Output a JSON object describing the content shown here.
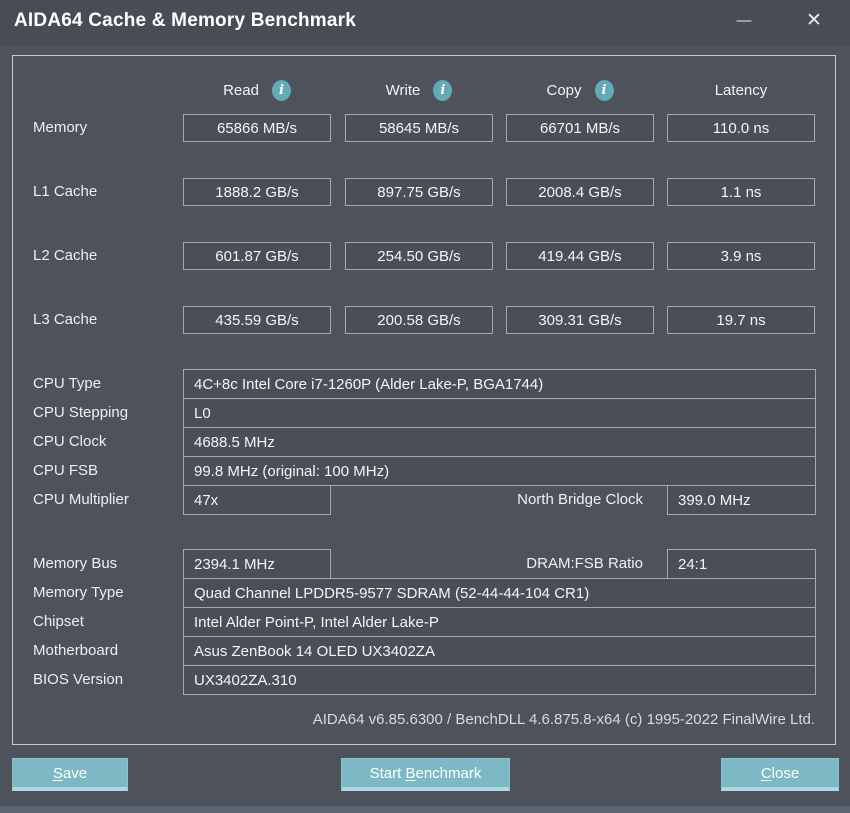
{
  "window": {
    "title": "AIDA64 Cache & Memory Benchmark",
    "minimize_icon": "—",
    "close_icon": "✕"
  },
  "colors": {
    "window_bg": "#4d525b",
    "titlebar_bg": "#484c55",
    "panel_border": "#c7c9cc",
    "box_bg": "#494e57",
    "box_border": "#a4a9b0",
    "info_icon_teal": "#64a9b7",
    "button_teal": "#7db8c5",
    "button_highlight": "#abdae2",
    "text": "#f4f5f7"
  },
  "info_icon_glyph": "i",
  "benchmark": {
    "columns": [
      {
        "label": "Read"
      },
      {
        "label": "Write"
      },
      {
        "label": "Copy"
      },
      {
        "label": "Latency"
      }
    ],
    "rows": [
      {
        "label": "Memory",
        "read": "65866 MB/s",
        "write": "58645 MB/s",
        "copy": "66701 MB/s",
        "latency": "110.0 ns"
      },
      {
        "label": "L1 Cache",
        "read": "1888.2 GB/s",
        "write": "897.75 GB/s",
        "copy": "2008.4 GB/s",
        "latency": "1.1 ns"
      },
      {
        "label": "L2 Cache",
        "read": "601.87 GB/s",
        "write": "254.50 GB/s",
        "copy": "419.44 GB/s",
        "latency": "3.9 ns"
      },
      {
        "label": "L3 Cache",
        "read": "435.59 GB/s",
        "write": "200.58 GB/s",
        "copy": "309.31 GB/s",
        "latency": "19.7 ns"
      }
    ]
  },
  "cpu_info": {
    "rows": [
      {
        "label": "CPU Type",
        "value": "4C+8c Intel Core i7-1260P  (Alder Lake-P, BGA1744)"
      },
      {
        "label": "CPU Stepping",
        "value": "L0"
      },
      {
        "label": "CPU Clock",
        "value": "4688.5 MHz"
      },
      {
        "label": "CPU FSB",
        "value": "99.8 MHz  (original: 100 MHz)"
      },
      {
        "label": "CPU Multiplier",
        "value": "47x",
        "right_label": "North Bridge Clock",
        "right_value": "399.0 MHz"
      }
    ]
  },
  "memory_info": {
    "rows": [
      {
        "label": "Memory Bus",
        "value": "2394.1 MHz",
        "right_label": "DRAM:FSB Ratio",
        "right_value": "24:1"
      },
      {
        "label": "Memory Type",
        "value": "Quad Channel LPDDR5-9577 SDRAM  (52-44-44-104 CR1)"
      },
      {
        "label": "Chipset",
        "value": "Intel Alder Point-P, Intel Alder Lake-P"
      },
      {
        "label": "Motherboard",
        "value": "Asus ZenBook 14 OLED UX3402ZA"
      },
      {
        "label": "BIOS Version",
        "value": "UX3402ZA.310"
      }
    ]
  },
  "footer": {
    "version_text": "AIDA64 v6.85.6300 / BenchDLL 4.6.875.8-x64  (c) 1995-2022 FinalWire Ltd."
  },
  "buttons": {
    "save": {
      "pre": "",
      "mnemonic": "S",
      "rest": "ave"
    },
    "start": {
      "pre": "Start ",
      "mnemonic": "B",
      "rest": "enchmark"
    },
    "close": {
      "pre": "",
      "mnemonic": "C",
      "rest": "lose"
    }
  }
}
